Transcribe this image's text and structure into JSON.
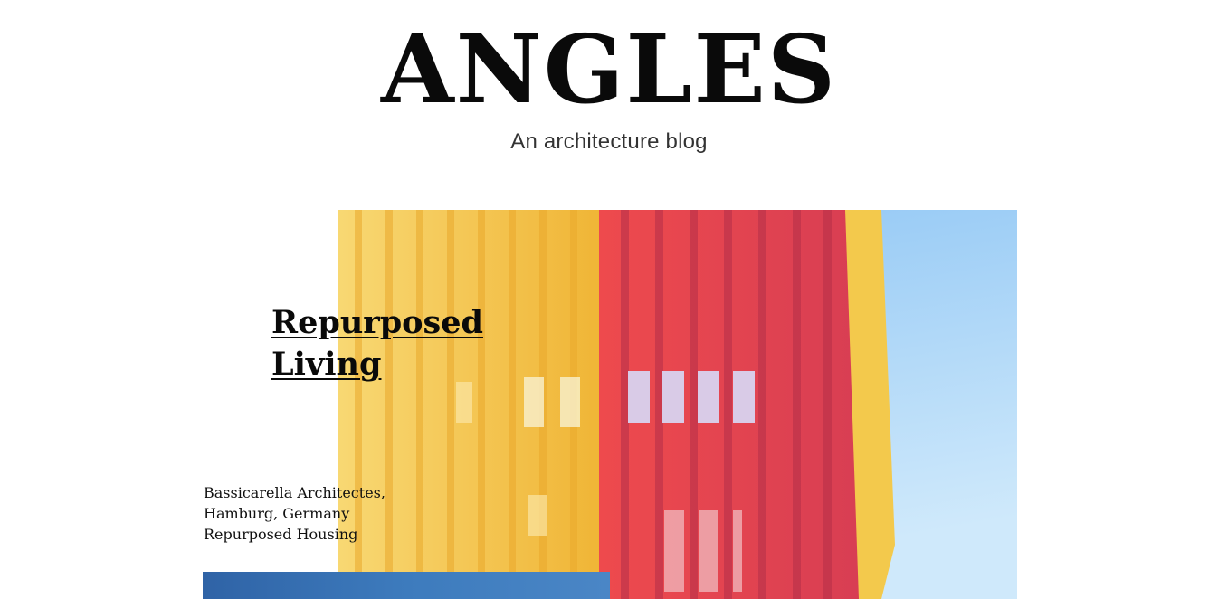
{
  "site": {
    "title": "ANGLES",
    "tagline": "An architecture blog"
  },
  "posts": [
    {
      "title_line1": "Repurposed",
      "title_line2": "Living",
      "meta_line1": "Bassicarella Architectes,",
      "meta_line2": "Hamburg, Germany",
      "meta_line3": "Repurposed Housing",
      "image": "colorful-facade-building-photo"
    },
    {
      "image": "blue-sky-building-photo"
    }
  ],
  "colors": {
    "yellow": "#f5c03f",
    "red": "#e8424a",
    "sky": "#9fd0f5"
  }
}
